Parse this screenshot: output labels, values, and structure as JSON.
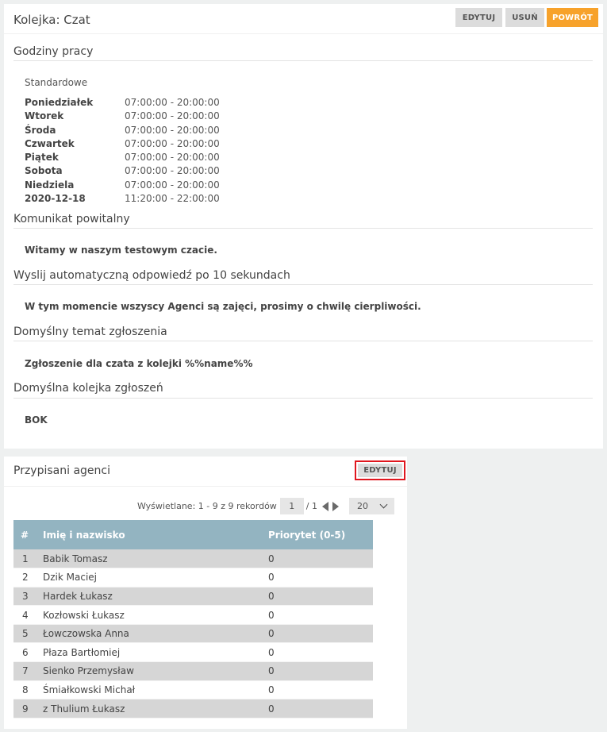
{
  "queue_panel": {
    "title": "Kolejka: Czat",
    "buttons": {
      "edit": "EDYTUJ",
      "delete": "USUŃ",
      "back": "POWRÓT"
    },
    "working_hours": {
      "title": "Godziny pracy",
      "subtitle": "Standardowe",
      "rows": [
        {
          "day": "Poniedziałek",
          "time": "07:00:00 - 20:00:00"
        },
        {
          "day": "Wtorek",
          "time": "07:00:00 - 20:00:00"
        },
        {
          "day": "Środa",
          "time": "07:00:00 - 20:00:00"
        },
        {
          "day": "Czwartek",
          "time": "07:00:00 - 20:00:00"
        },
        {
          "day": "Piątek",
          "time": "07:00:00 - 20:00:00"
        },
        {
          "day": "Sobota",
          "time": "07:00:00 - 20:00:00"
        },
        {
          "day": "Niedziela",
          "time": "07:00:00 - 20:00:00"
        },
        {
          "day": "2020-12-18",
          "time": "11:20:00 - 22:00:00"
        }
      ]
    },
    "welcome": {
      "title": "Komunikat powitalny",
      "value": "Witamy w naszym testowym czacie."
    },
    "auto_reply": {
      "title": "Wyslij automatyczną odpowiedź po 10 sekundach",
      "value": "W tym momencie wszyscy Agenci są zajęci, prosimy o chwilę cierpliwości."
    },
    "default_subject": {
      "title": "Domyślny temat zgłoszenia",
      "value": "Zgłoszenie dla czata z kolejki %%name%%"
    },
    "default_queue": {
      "title": "Domyślna kolejka zgłoszeń",
      "value": "BOK"
    }
  },
  "agents_panel": {
    "title": "Przypisani agenci",
    "edit_label": "EDYTUJ",
    "pager": {
      "info": "Wyświetlane: 1 - 9 z 9 rekordów",
      "page": "1",
      "total": "/ 1",
      "per_page": "20"
    },
    "columns": [
      "#",
      "Imię i nazwisko",
      "Priorytet (0-5)"
    ],
    "rows": [
      {
        "n": "1",
        "name": "Babik Tomasz",
        "priority": "0"
      },
      {
        "n": "2",
        "name": "Dzik Maciej",
        "priority": "0"
      },
      {
        "n": "3",
        "name": "Hardek Łukasz",
        "priority": "0"
      },
      {
        "n": "4",
        "name": "Kozłowski Łukasz",
        "priority": "0"
      },
      {
        "n": "5",
        "name": "Łowczowska Anna",
        "priority": "0"
      },
      {
        "n": "6",
        "name": "Płaza Bartłomiej",
        "priority": "0"
      },
      {
        "n": "7",
        "name": "Sienko Przemysław",
        "priority": "0"
      },
      {
        "n": "8",
        "name": "Śmiałkowski Michał",
        "priority": "0"
      },
      {
        "n": "9",
        "name": "z Thulium Łukasz",
        "priority": "0"
      }
    ],
    "colors": {
      "header": "#93b4c1",
      "highlight": "#e0161e"
    }
  },
  "colors": {
    "accent": "#f7a22b",
    "button_grey": "#dcdcdc"
  }
}
